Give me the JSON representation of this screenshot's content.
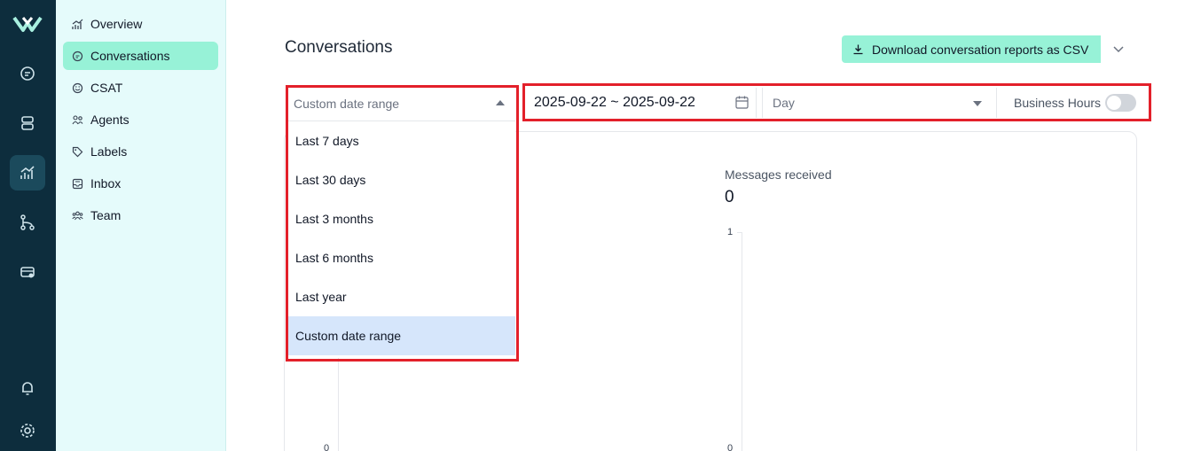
{
  "rail": {
    "icons": [
      "logo-icon",
      "chat-bubble-icon",
      "contacts-icon",
      "reports-icon",
      "campaign-flow-icon",
      "library-icon",
      "notification-bell-icon",
      "settings-gear-icon"
    ],
    "active": "reports-icon"
  },
  "sidebar": {
    "items": [
      {
        "label": "Overview",
        "icon": "chart-bars-icon"
      },
      {
        "label": "Conversations",
        "icon": "chat-icon"
      },
      {
        "label": "CSAT",
        "icon": "smiley-icon"
      },
      {
        "label": "Agents",
        "icon": "people-icon"
      },
      {
        "label": "Labels",
        "icon": "tag-icon"
      },
      {
        "label": "Inbox",
        "icon": "inbox-icon"
      },
      {
        "label": "Team",
        "icon": "team-icon"
      }
    ],
    "active_index": 1
  },
  "header": {
    "title": "Conversations",
    "download_label": "Download conversation reports as CSV"
  },
  "filters": {
    "date_range_select": "Custom date range",
    "date_options": [
      "Last 7 days",
      "Last 30 days",
      "Last 3 months",
      "Last 6 months",
      "Last year",
      "Custom date range"
    ],
    "selected_option": "Custom date range",
    "date_range_value": "2025-09-22 ~ 2025-09-22",
    "group_by": "Day",
    "business_hours_label": "Business Hours",
    "business_hours_on": false
  },
  "metric": {
    "label": "Messages received",
    "value": "0",
    "y_tick_top": "1",
    "y_tick_bottom": "0"
  },
  "colors": {
    "rail_bg": "#0d2d3d",
    "sidebar_bg": "#e5fbfb",
    "accent": "#97f2d7",
    "highlight_frame": "#e3202a",
    "selected_option_bg": "#d6e6fb"
  }
}
